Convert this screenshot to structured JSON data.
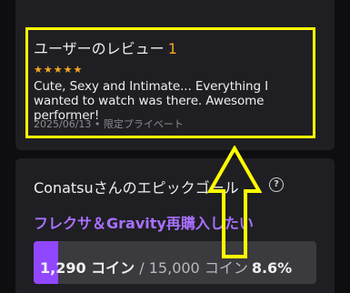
{
  "review": {
    "title": "ユーザーのレビュー",
    "count": "1",
    "stars": "★★★★★",
    "rating": 5,
    "text": "Cute, Sexy and Intimate... Everything I wanted to watch was there. Awesome performer!",
    "date": "2025/06/13",
    "separator": " • ",
    "visibility": "限定プライベート"
  },
  "epic_goal": {
    "title": "Conatsuさんのエピックゴール",
    "help_icon": "?",
    "goal_name": "フレクサ＆Gravity再購入したい",
    "current": "1,290",
    "current_unit": " コイン",
    "separator": " / ",
    "total": "15,000",
    "total_unit": " コイン",
    "percent": "8.6%",
    "progress_fraction": 0.086
  },
  "colors": {
    "highlight": "#ffff00",
    "accent_purple": "#9147ff",
    "star": "#f5a623"
  }
}
